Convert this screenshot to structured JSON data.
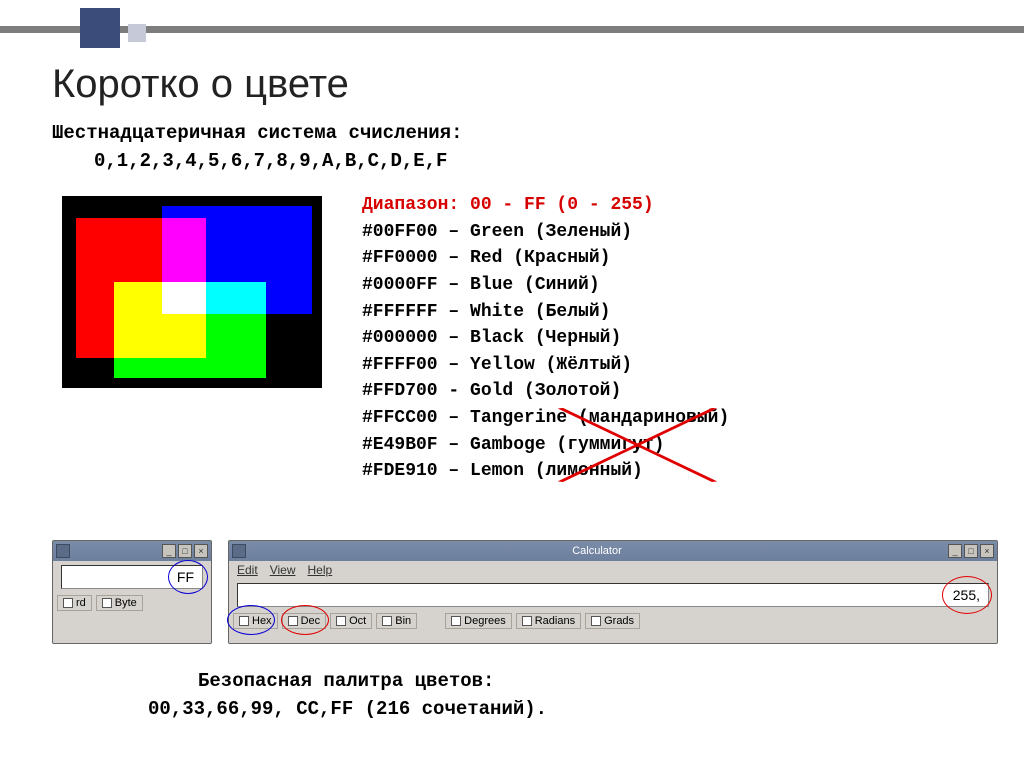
{
  "title": "Коротко о цвете",
  "subtitle": "Шестнадцатеричная система счисления:",
  "digits": "0,1,2,3,4,5,6,7,8,9,A,B,C,D,E,F",
  "range": "Диапазон: 00 - FF (0 - 255)",
  "colors": [
    "#00FF00 – Green (Зеленый)",
    "#FF0000 – Red (Красный)",
    "#0000FF – Blue (Синий)",
    "#FFFFFF – White (Белый)",
    "#000000 – Black (Черный)",
    "#FFFF00 – Yellow (Жёлтый)",
    "#FFD700 - Gold (Золотой)"
  ],
  "colors_crossed": [
    "#FFCC00 – Tangerine (мандариновый)",
    "#E49B0F – Gamboge (гуммигут)",
    "#FDE910 – Lemon (лимонный)"
  ],
  "calc": {
    "title": "Calculator",
    "menu": {
      "edit": "Edit",
      "view": "View",
      "help": "Help"
    },
    "display_small": "FF",
    "display_large": "255,",
    "small_radios": {
      "rd": "rd",
      "byte": "Byte"
    },
    "base": {
      "hex": "Hex",
      "dec": "Dec",
      "oct": "Oct",
      "bin": "Bin"
    },
    "angle": {
      "deg": "Degrees",
      "rad": "Radians",
      "grad": "Grads"
    }
  },
  "footer1": "Безопасная палитра цветов:",
  "footer2": "00,33,66,99, CC,FF (216 сочетаний)."
}
